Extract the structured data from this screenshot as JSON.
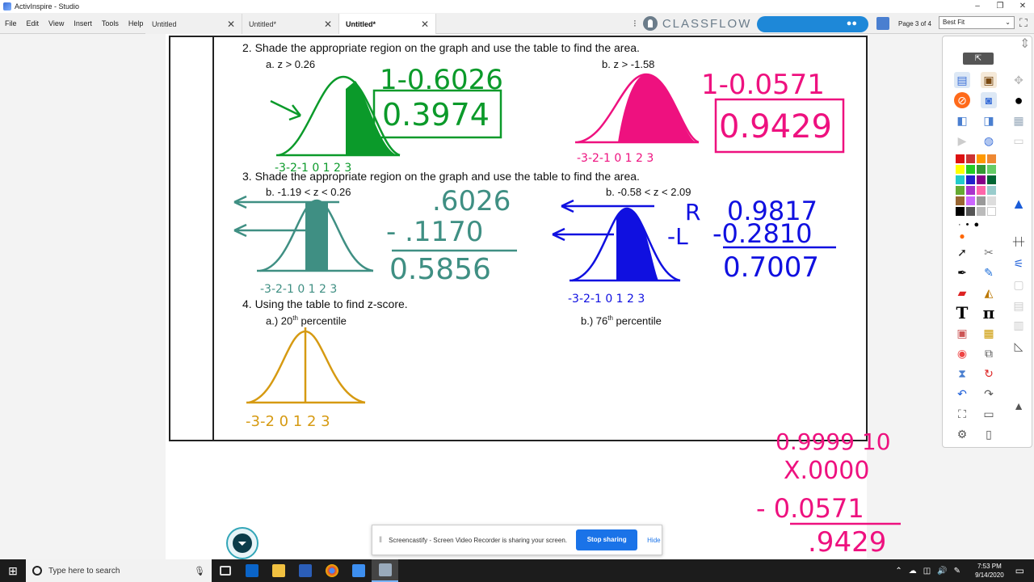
{
  "window": {
    "title": "ActivInspire - Studio",
    "controls": [
      "–",
      "❐",
      "✕"
    ]
  },
  "menu": [
    "File",
    "Edit",
    "View",
    "Insert",
    "Tools",
    "Help"
  ],
  "tabs": [
    {
      "label": "Untitled",
      "active": false
    },
    {
      "label": "Untitled*",
      "active": false
    },
    {
      "label": "Untitled*",
      "active": true
    }
  ],
  "classflow": {
    "logo_text": "CLASSFLOW",
    "users_icon": "users-icon"
  },
  "page_indicator": "Page 3 of 4",
  "zoom": {
    "selected": "Best Fit"
  },
  "worksheet": {
    "q2": {
      "title": "2.   Shade the appropriate region on the graph and use the table to find the area.",
      "a": "a.   z > 0.26",
      "b": "b. z > -1.58"
    },
    "q3": {
      "title": "3.   Shade the appropriate region on the graph and use the table to find the area.",
      "a": "b.   -1.19 < z < 0.26",
      "b": "b. -0.58 < z < 2.09"
    },
    "q4": {
      "title": "4.    Using the table to find z-score.",
      "a_prefix": "a.)  20",
      "a_sup": "th",
      "a_suffix": " percentile",
      "b_prefix": "b.) 76",
      "b_sup": "th",
      "b_suffix": " percentile"
    }
  },
  "handwriting": {
    "q2a_line1": "1-0.6026",
    "q2a_answer": "0.3974",
    "q2b_line1": "1-0.0571",
    "q2b_answer": "0.9429",
    "q3a_line1": ".6026",
    "q3a_line2": "- .1170",
    "q3a_answer": "0.5856",
    "q3b_r": "R",
    "q3b_l": "-L",
    "q3b_line1": "0.9817",
    "q3b_line2": "-0.2810",
    "q3b_answer": "0.7007",
    "axis_labels": "-3-2-1 0 1 2 3",
    "q4_axis": "-3-2  0 1 2 3",
    "side_line1": "0.9999 10",
    "side_line2": "X.0000",
    "side_line3": "- 0.0571",
    "side_answer": ".9429"
  },
  "colors": {
    "green": "#0b9a2a",
    "pink": "#ee117f",
    "teal": "#3f8f83",
    "blue": "#1010e0",
    "gold": "#d69a12"
  },
  "toolbox": {
    "drag_icon": "expand-icon"
  },
  "share_bar": {
    "message": "Screencastify - Screen Video Recorder is sharing your screen.",
    "stop_label": "Stop sharing",
    "hide_label": "Hide"
  },
  "taskbar": {
    "search_placeholder": "Type here to search",
    "time": "7:53 PM",
    "date": "9/14/2020"
  }
}
